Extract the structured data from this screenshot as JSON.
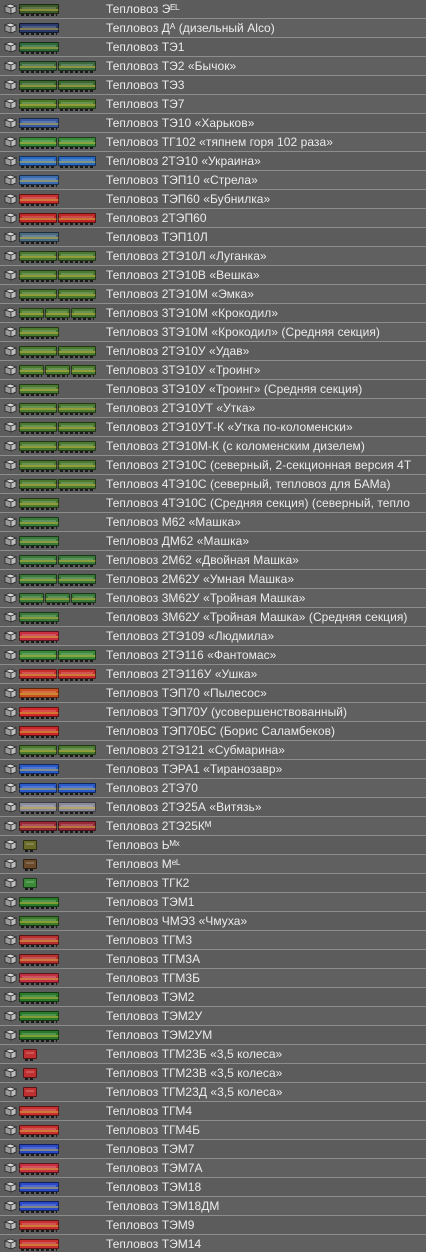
{
  "list": {
    "items": [
      {
        "label": "Тепловоз Эᴱᴸ",
        "colors": [
          "#3c5a2a"
        ],
        "cars": 1
      },
      {
        "label": "Тепловоз Дᴬ (дизельный Alco)",
        "colors": [
          "#2a3a6a"
        ],
        "cars": 1
      },
      {
        "label": "Тепловоз ТЭ1",
        "colors": [
          "#2f6a3a"
        ],
        "cars": 1
      },
      {
        "label": "Тепловоз ТЭ2 «Бычок»",
        "colors": [
          "#3c6a40"
        ],
        "cars": 2
      },
      {
        "label": "Тепловоз ТЭ3",
        "colors": [
          "#3a6a30"
        ],
        "cars": 2
      },
      {
        "label": "Тепловоз ТЭ7",
        "colors": [
          "#4a7a2a"
        ],
        "cars": 2
      },
      {
        "label": "Тепловоз ТЭ10 «Харьков»",
        "colors": [
          "#3a5aa0"
        ],
        "cars": 1
      },
      {
        "label": "Тепловоз ТГ102 «тяпнем горя 102 раза»",
        "colors": [
          "#3a8a3a"
        ],
        "cars": 2
      },
      {
        "label": "Тепловоз 2ТЭ10 «Украина»",
        "colors": [
          "#2a6ac0"
        ],
        "cars": 2
      },
      {
        "label": "Тепловоз ТЭП10 «Стрела»",
        "colors": [
          "#3a6ab0"
        ],
        "cars": 1
      },
      {
        "label": "Тепловоз ТЭП60 «Бубнилка»",
        "colors": [
          "#c83030"
        ],
        "cars": 1
      },
      {
        "label": "Тепловоз 2ТЭП60",
        "colors": [
          "#c02828"
        ],
        "cars": 2
      },
      {
        "label": "Тепловоз ТЭП10Л",
        "colors": [
          "#4a6a80"
        ],
        "cars": 1
      },
      {
        "label": "Тепловоз 2ТЭ10Л «Луганка»",
        "colors": [
          "#4a7a30"
        ],
        "cars": 2
      },
      {
        "label": "Тепловоз 2ТЭ10В «Вешка»",
        "colors": [
          "#4a7a30"
        ],
        "cars": 2
      },
      {
        "label": "Тепловоз 2ТЭ10М «Эмка»",
        "colors": [
          "#4a7a30"
        ],
        "cars": 2
      },
      {
        "label": "Тепловоз 3ТЭ10М «Крокодил»",
        "colors": [
          "#4a7a30"
        ],
        "cars": 3
      },
      {
        "label": "Тепловоз 3ТЭ10М «Крокодил» (Средняя секция)",
        "colors": [
          "#4a7a30"
        ],
        "cars": 1
      },
      {
        "label": "Тепловоз 2ТЭ10У «Удав»",
        "colors": [
          "#4a7a30"
        ],
        "cars": 2
      },
      {
        "label": "Тепловоз 3ТЭ10У «Троинг»",
        "colors": [
          "#4a7a30"
        ],
        "cars": 3
      },
      {
        "label": "Тепловоз 3ТЭ10У «Троинг» (Средняя секция)",
        "colors": [
          "#4a7a30"
        ],
        "cars": 1
      },
      {
        "label": "Тепловоз 2ТЭ10УТ «Утка»",
        "colors": [
          "#4a7a30"
        ],
        "cars": 2
      },
      {
        "label": "Тепловоз 2ТЭ10УТ-К «Утка по-коломенски»",
        "colors": [
          "#4a7a30"
        ],
        "cars": 2
      },
      {
        "label": "Тепловоз 2ТЭ10М-К (с коломенским дизелем)",
        "colors": [
          "#4a7a30"
        ],
        "cars": 2
      },
      {
        "label": "Тепловоз 2ТЭ10С (северный, 2-секционная версия 4Т",
        "colors": [
          "#4a7a30"
        ],
        "cars": 2
      },
      {
        "label": "Тепловоз 4ТЭ10С (северный, тепловоз для БАМа)",
        "colors": [
          "#4a7a30"
        ],
        "cars": 2
      },
      {
        "label": "Тепловоз 4ТЭ10С (Средняя секция) (северный, тепло",
        "colors": [
          "#4a7a30"
        ],
        "cars": 1
      },
      {
        "label": "Тепловоз М62 «Машка»",
        "colors": [
          "#3a7a3a"
        ],
        "cars": 1
      },
      {
        "label": "Тепловоз ДМ62 «Машка»",
        "colors": [
          "#3a7a3a"
        ],
        "cars": 1
      },
      {
        "label": "Тепловоз 2М62 «Двойная Машка»",
        "colors": [
          "#3a7a3a"
        ],
        "cars": 2
      },
      {
        "label": "Тепловоз 2М62У «Умная Машка»",
        "colors": [
          "#3a7a3a"
        ],
        "cars": 2
      },
      {
        "label": "Тепловоз 3М62У «Тройная Машка»",
        "colors": [
          "#3a7a3a"
        ],
        "cars": 3
      },
      {
        "label": "Тепловоз 3М62У «Тройная Машка» (Средняя секция)",
        "colors": [
          "#3a7a3a"
        ],
        "cars": 1
      },
      {
        "label": "Тепловоз 2ТЭ109 «Людмила»",
        "colors": [
          "#c83040"
        ],
        "cars": 1
      },
      {
        "label": "Тепловоз 2ТЭ116 «Фантомас»",
        "colors": [
          "#3a8a3a"
        ],
        "cars": 2
      },
      {
        "label": "Тепловоз 2ТЭ116У «Ушка»",
        "colors": [
          "#c83030"
        ],
        "cars": 2
      },
      {
        "label": "Тепловоз ТЭП70 «Пылесос»",
        "colors": [
          "#c85020"
        ],
        "cars": 1
      },
      {
        "label": "Тепловоз ТЭП70У (усовершенствованный)",
        "colors": [
          "#d02828"
        ],
        "cars": 1
      },
      {
        "label": "Тепловоз ТЭП70БС (Борис Саламбеков)",
        "colors": [
          "#c82828"
        ],
        "cars": 1
      },
      {
        "label": "Тепловоз 2ТЭ121 «Субмарина»",
        "colors": [
          "#4a7a30"
        ],
        "cars": 2
      },
      {
        "label": "Тепловоз ТЭРА1 «Тиранозавр»",
        "colors": [
          "#2a5ac8"
        ],
        "cars": 1
      },
      {
        "label": "Тепловоз 2ТЭ70",
        "colors": [
          "#2a5ac8"
        ],
        "cars": 2
      },
      {
        "label": "Тепловоз 2ТЭ25А «Витязь»",
        "colors": [
          "#8a8a9a"
        ],
        "cars": 2
      },
      {
        "label": "Тепловоз 2ТЭ25Кᴹ",
        "colors": [
          "#9a2a3a"
        ],
        "cars": 2
      },
      {
        "label": "Тепловоз Ьᴹˣ",
        "colors": [
          "#6a6a2a"
        ],
        "cars": 1,
        "small": true
      },
      {
        "label": "Тепловоз Мᵉᴸ",
        "colors": [
          "#6a4a2a"
        ],
        "cars": 1,
        "small": true
      },
      {
        "label": "Тепловоз ТГК2",
        "colors": [
          "#3a8a3a"
        ],
        "cars": 1,
        "small": true
      },
      {
        "label": "Тепловоз ТЭМ1",
        "colors": [
          "#2a7a2a"
        ],
        "cars": 1
      },
      {
        "label": "Тепловоз ЧМЭ3 «Чмуха»",
        "colors": [
          "#3a7a2a"
        ],
        "cars": 1
      },
      {
        "label": "Тепловоз ТГМ3",
        "colors": [
          "#b83030"
        ],
        "cars": 1
      },
      {
        "label": "Тепловоз ТГМ3А",
        "colors": [
          "#b83030"
        ],
        "cars": 1
      },
      {
        "label": "Тепловоз ТГМ3Б",
        "colors": [
          "#c03040"
        ],
        "cars": 1
      },
      {
        "label": "Тепловоз ТЭМ2",
        "colors": [
          "#2a7a2a"
        ],
        "cars": 1
      },
      {
        "label": "Тепловоз ТЭМ2У",
        "colors": [
          "#2a7a2a"
        ],
        "cars": 1
      },
      {
        "label": "Тепловоз ТЭМ2УМ",
        "colors": [
          "#2a7a2a"
        ],
        "cars": 1
      },
      {
        "label": "Тепловоз ТГМ23Б «3,5 колеса»",
        "colors": [
          "#c03030"
        ],
        "cars": 1,
        "small": true
      },
      {
        "label": "Тепловоз ТГМ23В «3,5 колеса»",
        "colors": [
          "#c03030"
        ],
        "cars": 1,
        "small": true
      },
      {
        "label": "Тепловоз ТГМ23Д «3,5 колеса»",
        "colors": [
          "#c03030"
        ],
        "cars": 1,
        "small": true
      },
      {
        "label": "Тепловоз ТГМ4",
        "colors": [
          "#c83030"
        ],
        "cars": 1
      },
      {
        "label": "Тепловоз ТГМ4Б",
        "colors": [
          "#c83030"
        ],
        "cars": 1
      },
      {
        "label": "Тепловоз ТЭМ7",
        "colors": [
          "#2a4ac8"
        ],
        "cars": 1
      },
      {
        "label": "Тепловоз ТЭМ7А",
        "colors": [
          "#c83040"
        ],
        "cars": 1
      },
      {
        "label": "Тепловоз ТЭМ18",
        "colors": [
          "#2a4ac8"
        ],
        "cars": 1
      },
      {
        "label": "Тепловоз ТЭМ18ДМ",
        "colors": [
          "#2a4ac8"
        ],
        "cars": 1
      },
      {
        "label": "Тепловоз ТЭМ9",
        "colors": [
          "#c83030"
        ],
        "cars": 1
      },
      {
        "label": "Тепловоз ТЭМ14",
        "colors": [
          "#c83030"
        ],
        "cars": 1
      }
    ]
  }
}
